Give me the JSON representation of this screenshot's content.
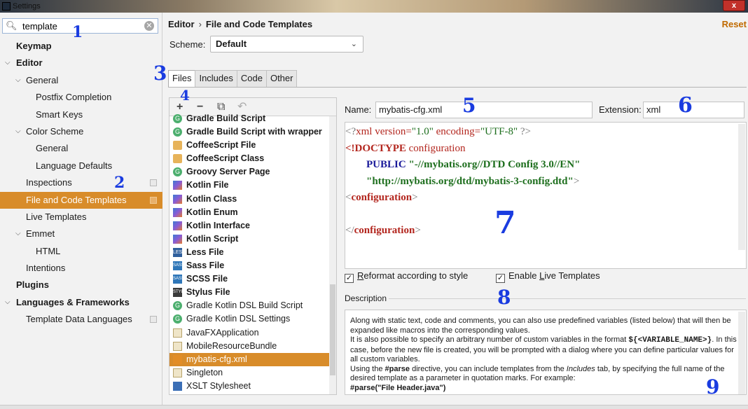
{
  "window": {
    "title": "Settings",
    "close_label": "x"
  },
  "search": {
    "value": "template",
    "clear_label": "✕"
  },
  "sidebar": {
    "items": [
      {
        "label": "Keymap"
      },
      {
        "label": "Editor"
      },
      {
        "label": "General"
      },
      {
        "label": "Postfix Completion"
      },
      {
        "label": "Smart Keys"
      },
      {
        "label": "Color Scheme"
      },
      {
        "label": "General"
      },
      {
        "label": "Language Defaults"
      },
      {
        "label": "Inspections"
      },
      {
        "label": "File and Code Templates"
      },
      {
        "label": "Live Templates"
      },
      {
        "label": "Emmet"
      },
      {
        "label": "HTML"
      },
      {
        "label": "Intentions"
      },
      {
        "label": "Plugins"
      },
      {
        "label": "Languages & Frameworks"
      },
      {
        "label": "Template Data Languages"
      }
    ]
  },
  "breadcrumb": {
    "parent": "Editor",
    "separator": "›",
    "current": "File and Code Templates"
  },
  "reset_label": "Reset",
  "scheme": {
    "label": "Scheme:",
    "value": "Default"
  },
  "tabs": [
    {
      "label": "Files"
    },
    {
      "label": "Includes"
    },
    {
      "label": "Code"
    },
    {
      "label": "Other"
    }
  ],
  "toolbar": {
    "add": "+",
    "remove": "−",
    "copy": "⧉",
    "reset": "↶"
  },
  "templates": [
    {
      "label": "Gradle Build Script",
      "icon": "gradle-icon"
    },
    {
      "label": "Gradle Build Script with wrapper",
      "icon": "gradle-icon"
    },
    {
      "label": "CoffeeScript File",
      "icon": "coffeescript-icon"
    },
    {
      "label": "CoffeeScript Class",
      "icon": "coffeescript-icon"
    },
    {
      "label": "Groovy Server Page",
      "icon": "groovy-icon"
    },
    {
      "label": "Kotlin File",
      "icon": "kotlin-icon"
    },
    {
      "label": "Kotlin Class",
      "icon": "kotlin-icon"
    },
    {
      "label": "Kotlin Enum",
      "icon": "kotlin-icon"
    },
    {
      "label": "Kotlin Interface",
      "icon": "kotlin-icon"
    },
    {
      "label": "Kotlin Script",
      "icon": "kotlin-icon"
    },
    {
      "label": "Less File",
      "icon": "less-icon",
      "badge": "LESS"
    },
    {
      "label": "Sass File",
      "icon": "sass-icon",
      "badge": "SASS"
    },
    {
      "label": "SCSS File",
      "icon": "scss-icon",
      "badge": "SASS"
    },
    {
      "label": "Stylus File",
      "icon": "stylus-icon",
      "badge": "STYL"
    },
    {
      "label": "Gradle Kotlin DSL Build Script",
      "icon": "gradle-icon"
    },
    {
      "label": "Gradle Kotlin DSL Settings",
      "icon": "gradle-icon"
    },
    {
      "label": "JavaFXApplication",
      "icon": "java-file-icon"
    },
    {
      "label": "MobileResourceBundle",
      "icon": "java-file-icon"
    },
    {
      "label": "mybatis-cfg.xml",
      "icon": "xml-icon"
    },
    {
      "label": "Singleton",
      "icon": "java-file-icon"
    },
    {
      "label": "XSLT Stylesheet",
      "icon": "xml-icon"
    }
  ],
  "name_field": {
    "label": "Name:",
    "value": "mybatis-cfg.xml"
  },
  "extension_field": {
    "label": "Extension:",
    "value": "xml"
  },
  "code": {
    "l1_open": "<?",
    "l1_tag": "xml",
    "l1_a1": " version=",
    "l1_v1": "\"1.0\"",
    "l1_a2": " encoding=",
    "l1_v2": "\"UTF-8\"",
    "l1_close": " ?>",
    "l2_doctype": "<!DOCTYPE",
    "l2_name": " configuration",
    "l3_indent": "        ",
    "l3_public": "PUBLIC",
    "l3_str": " \"-//mybatis.org//DTD Config 3.0//EN\"",
    "l4_indent": "        ",
    "l4_str": "\"http://mybatis.org/dtd/mybatis-3-config.dtd\"",
    "l4_close": ">",
    "l5_open": "<",
    "l5_tag": "configuration",
    "l5_close": ">",
    "l7_open": "</",
    "l7_tag": "configuration",
    "l7_close": ">"
  },
  "options": {
    "reformat_pre": "",
    "reformat_u": "R",
    "reformat_post": "eformat according to style",
    "live_pre": "Enable ",
    "live_u": "L",
    "live_post": "ive Templates"
  },
  "description": {
    "label": "Description",
    "p1": "Along with static text, code and comments, you can also use predefined variables (listed below) that will then be expanded like macros into the corresponding values.",
    "p2a": "It is also possible to specify an arbitrary number of custom variables in the format ",
    "p2b": "${<VARIABLE_NAME>}",
    "p2c": ". In this case, before the new file is created, you will be prompted with a dialog where you can define particular values for all custom variables.",
    "p3a": "Using the ",
    "p3b": "#parse",
    "p3c": " directive, you can include templates from the ",
    "p3d": "Includes",
    "p3e": " tab, by specifying the full name of the desired template as a parameter in quotation marks. For example:",
    "p4": "#parse(\"File Header.java\")"
  },
  "annotations": [
    "1",
    "2",
    "3",
    "4",
    "5",
    "6",
    "7",
    "8",
    "9"
  ],
  "colors": {
    "selection": "#d88c2a",
    "reset": "#c06a00",
    "annotation": "#1a3ce0"
  }
}
